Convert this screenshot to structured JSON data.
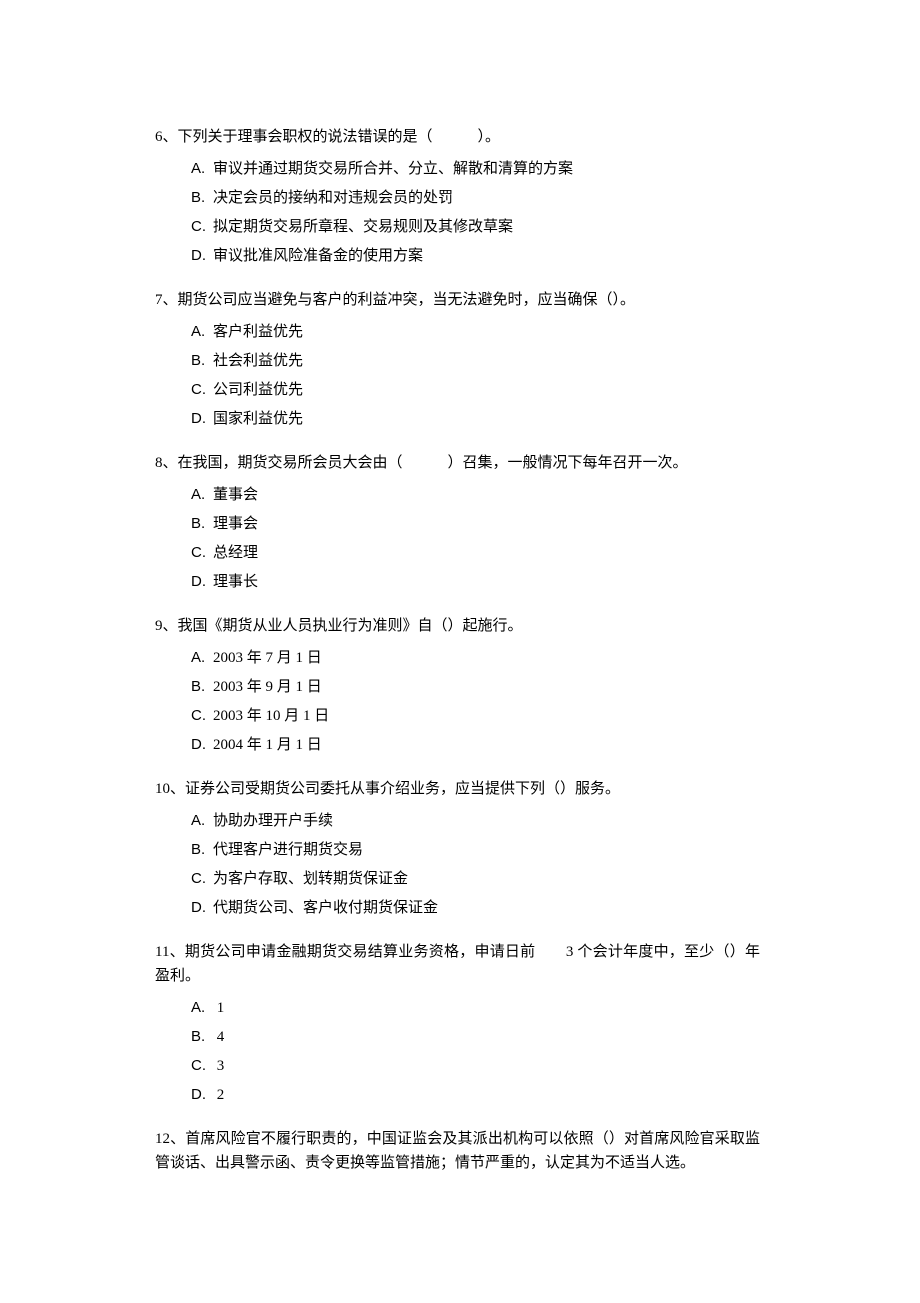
{
  "questions": [
    {
      "stem": "6、下列关于理事会职权的说法错误的是（　　　）。",
      "options": [
        {
          "letter": "A.",
          "text": "审议并通过期货交易所合并、分立、解散和清算的方案"
        },
        {
          "letter": "B.",
          "text": "决定会员的接纳和对违规会员的处罚"
        },
        {
          "letter": "C.",
          "text": "拟定期货交易所章程、交易规则及其修改草案"
        },
        {
          "letter": "D.",
          "text": "审议批准风险准备金的使用方案"
        }
      ]
    },
    {
      "stem": "7、期货公司应当避免与客户的利益冲突，当无法避免时，应当确保（）。",
      "options": [
        {
          "letter": "A.",
          "text": "客户利益优先"
        },
        {
          "letter": "B.",
          "text": "社会利益优先"
        },
        {
          "letter": "C.",
          "text": "公司利益优先"
        },
        {
          "letter": "D.",
          "text": "国家利益优先"
        }
      ]
    },
    {
      "stem": "8、在我国，期货交易所会员大会由（　　　）召集，一般情况下每年召开一次。",
      "options": [
        {
          "letter": "A.",
          "text": "董事会"
        },
        {
          "letter": "B.",
          "text": "理事会"
        },
        {
          "letter": "C.",
          "text": "总经理"
        },
        {
          "letter": "D.",
          "text": "理事长"
        }
      ]
    },
    {
      "stem": "9、我国《期货从业人员执业行为准则》自（）起施行。",
      "options": [
        {
          "letter": "A.",
          "text": "2003 年 7 月 1 日"
        },
        {
          "letter": "B.",
          "text": "2003 年 9 月 1 日"
        },
        {
          "letter": "C.",
          "text": "2003 年 10 月 1 日"
        },
        {
          "letter": "D.",
          "text": "2004 年 1 月 1 日"
        }
      ]
    },
    {
      "stem": "10、证券公司受期货公司委托从事介绍业务，应当提供下列（）服务。",
      "options": [
        {
          "letter": "A.",
          "text": "协助办理开户手续"
        },
        {
          "letter": "B.",
          "text": "代理客户进行期货交易"
        },
        {
          "letter": "C.",
          "text": "为客户存取、划转期货保证金"
        },
        {
          "letter": "D.",
          "text": "代期货公司、客户收付期货保证金"
        }
      ]
    },
    {
      "stem": "11、期货公司申请金融期货交易结算业务资格，申请日前　　3 个会计年度中，至少（）年盈利。",
      "options": [
        {
          "letter": "A.",
          "text": " 1"
        },
        {
          "letter": "B.",
          "text": " 4"
        },
        {
          "letter": "C.",
          "text": " 3"
        },
        {
          "letter": "D.",
          "text": " 2"
        }
      ]
    },
    {
      "stem": "12、首席风险官不履行职责的，中国证监会及其派出机构可以依照（）对首席风险官采取监管谈话、出具警示函、责令更换等监管措施；情节严重的，认定其为不适当人选。",
      "options": []
    }
  ]
}
